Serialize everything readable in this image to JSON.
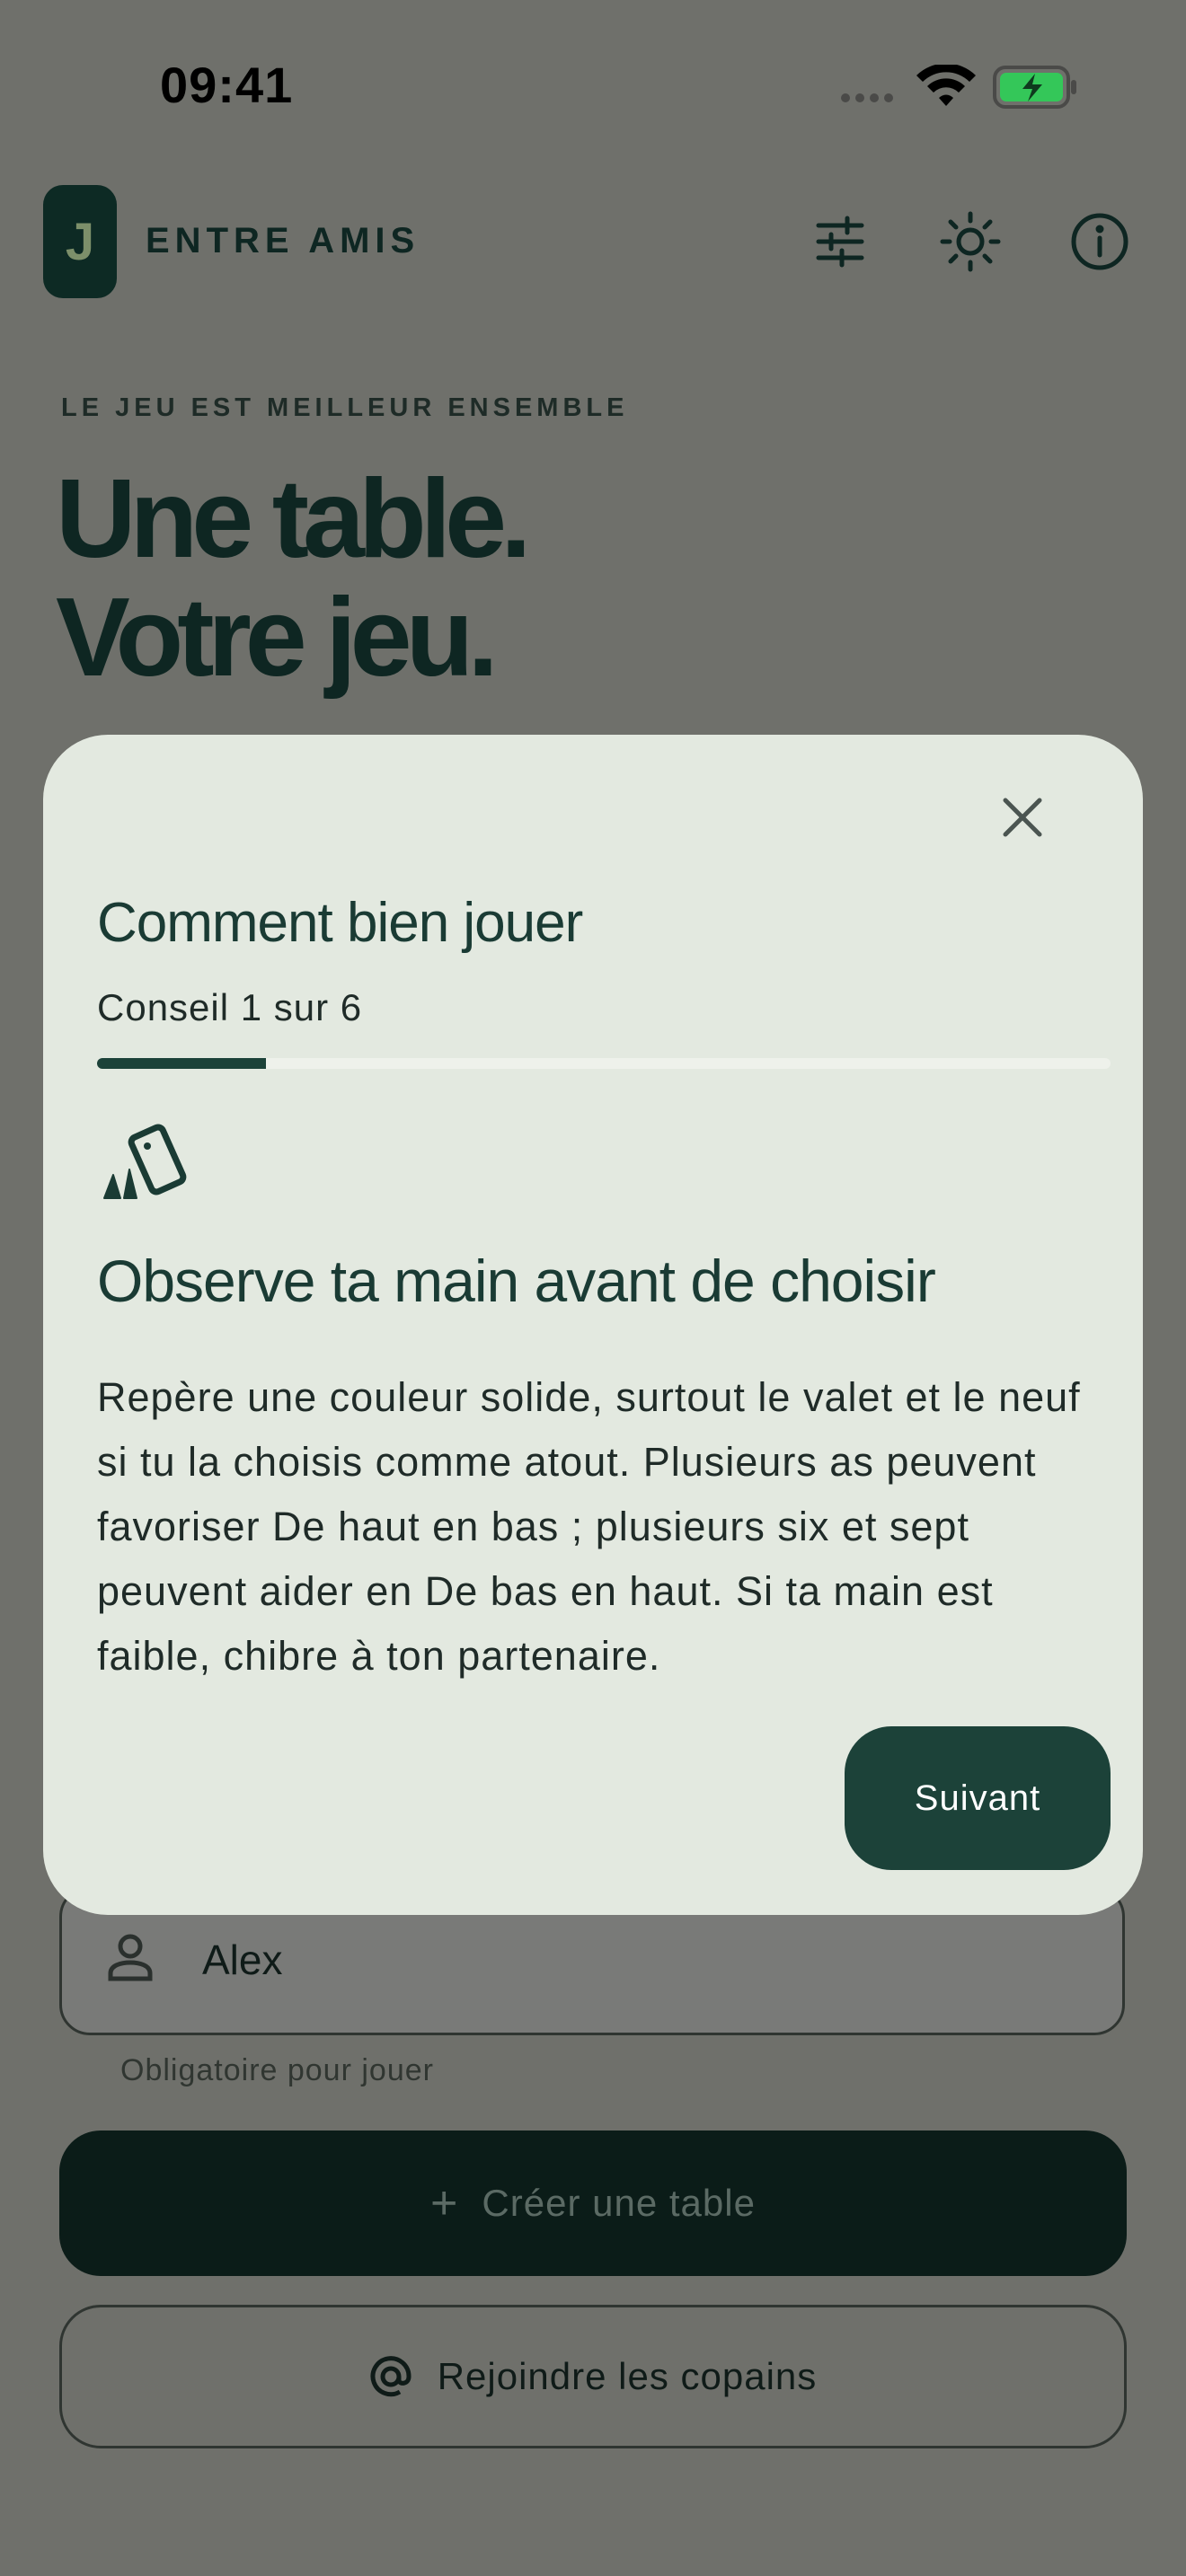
{
  "status_bar": {
    "time": "09:41",
    "battery_color": "#34c759"
  },
  "header": {
    "logo_letter": "J",
    "app_name": "ENTRE AMIS",
    "icons": [
      "tune-icon",
      "sun-icon",
      "info-icon"
    ]
  },
  "hero": {
    "kicker": "LE JEU EST MEILLEUR ENSEMBLE",
    "title_line1": "Une table.",
    "title_line2": "Votre jeu."
  },
  "form": {
    "name_value": "Alex",
    "name_helper": "Obligatoire pour jouer",
    "create_label": "Créer une table",
    "join_label": "Rejoindre les copains"
  },
  "dialog": {
    "title": "Comment bien jouer",
    "step_text": "Conseil 1 sur 6",
    "progress": 0.167,
    "tip_icon": "cards-icon",
    "tip_title": "Observe ta main avant de choisir",
    "tip_body": "Repère une couleur solide, surtout le valet et le neuf si tu la choisis comme atout. Plusieurs as peuvent favoriser De haut en bas ; plusieurs six et sept peuvent aider en De bas en haut. Si ta main est faible, chibre à ton partenaire.",
    "next_label": "Suivant"
  },
  "colors": {
    "accent": "#1c4239",
    "dialog_bg": "#e3e9e0",
    "scrim": "#6f706b"
  }
}
